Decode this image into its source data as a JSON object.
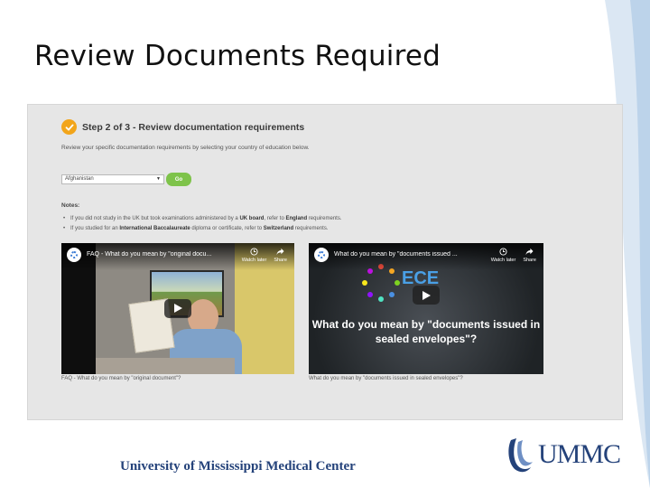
{
  "slide": {
    "title": "Review Documents Required"
  },
  "screenshot": {
    "step_title": "Step 2 of 3 - Review documentation requirements",
    "instructions": "Review your specific documentation requirements by selecting your country of education below.",
    "country_select": {
      "value": "Afghanistan"
    },
    "go_label": "Go",
    "notes_label": "Notes:",
    "notes": [
      {
        "pre": "If you did not study in the UK but took examinations administered by a ",
        "bold1": "UK board",
        "mid": ", refer to ",
        "bold2": "England",
        "post": " requirements."
      },
      {
        "pre": "If you studied for an ",
        "bold1": "International Baccalaureate",
        "mid": " diploma or certificate, refer to ",
        "bold2": "Switzerland",
        "post": " requirements."
      }
    ],
    "videos": [
      {
        "title": "FAQ - What do you mean by \"original docu...",
        "watch_later": "Watch later",
        "share": "Share",
        "caption": "FAQ - What do you mean by \"original document\"?"
      },
      {
        "title": "What do you mean by \"documents issued ...",
        "watch_later": "Watch later",
        "share": "Share",
        "logo_text": "ECE",
        "overlay_text": "What do you mean by \"documents issued in sealed envelopes\"?",
        "caption": "What do you mean by \"documents issued in sealed envelopes\"?"
      }
    ]
  },
  "footer": {
    "institution": "University of Mississippi Medical Center",
    "logo_text": "UMMC"
  }
}
